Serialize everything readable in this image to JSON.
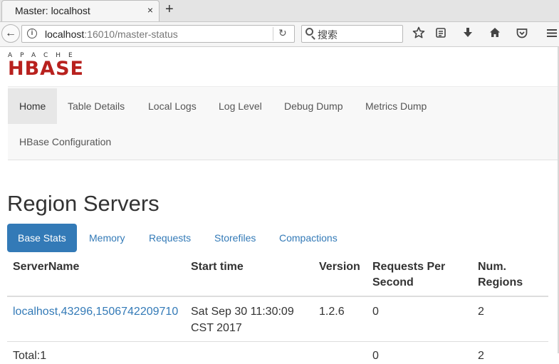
{
  "browser": {
    "tab_title": "Master: localhost",
    "tab_close": "×",
    "new_tab": "+",
    "back": "←",
    "url_host": "localhost",
    "url_rest": ":16010/master-status",
    "reload": "↻",
    "search_placeholder": "搜索",
    "toolbar_icons": [
      "star-icon",
      "reader-icon",
      "download-icon",
      "home-icon",
      "pocket-icon",
      "menu-icon"
    ]
  },
  "logo": {
    "top": "APACHE",
    "main": "HBASE"
  },
  "nav": {
    "items": [
      "Home",
      "Table Details",
      "Local Logs",
      "Log Level",
      "Debug Dump",
      "Metrics Dump",
      "HBase Configuration"
    ],
    "active": "Home"
  },
  "region_servers": {
    "title": "Region Servers",
    "tabs": [
      "Base Stats",
      "Memory",
      "Requests",
      "Storefiles",
      "Compactions"
    ],
    "active_tab": "Base Stats",
    "columns": [
      "ServerName",
      "Start time",
      "Version",
      "Requests Per Second",
      "Num. Regions"
    ],
    "rows": [
      {
        "server_name": "localhost,43296,1506742209710",
        "start_time": "Sat Sep 30 11:30:09 CST 2017",
        "version": "1.2.6",
        "requests_per_second": "0",
        "num_regions": "2"
      }
    ],
    "total_row": {
      "label": "Total:1",
      "requests_per_second": "0",
      "num_regions": "2"
    }
  }
}
